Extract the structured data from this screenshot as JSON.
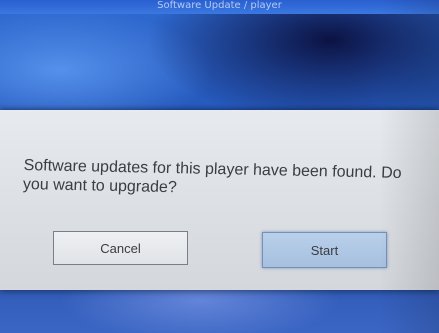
{
  "header": {
    "partial_text": "Software Update / player"
  },
  "dialog": {
    "message": "Software updates for this player have been found. Do you want to upgrade?",
    "cancel_label": "Cancel",
    "start_label": "Start"
  },
  "colors": {
    "background_blue": "#2456b8",
    "dialog_gray": "#dde0e4",
    "selected_button": "#b9d0ea",
    "text": "#3b3d42"
  }
}
